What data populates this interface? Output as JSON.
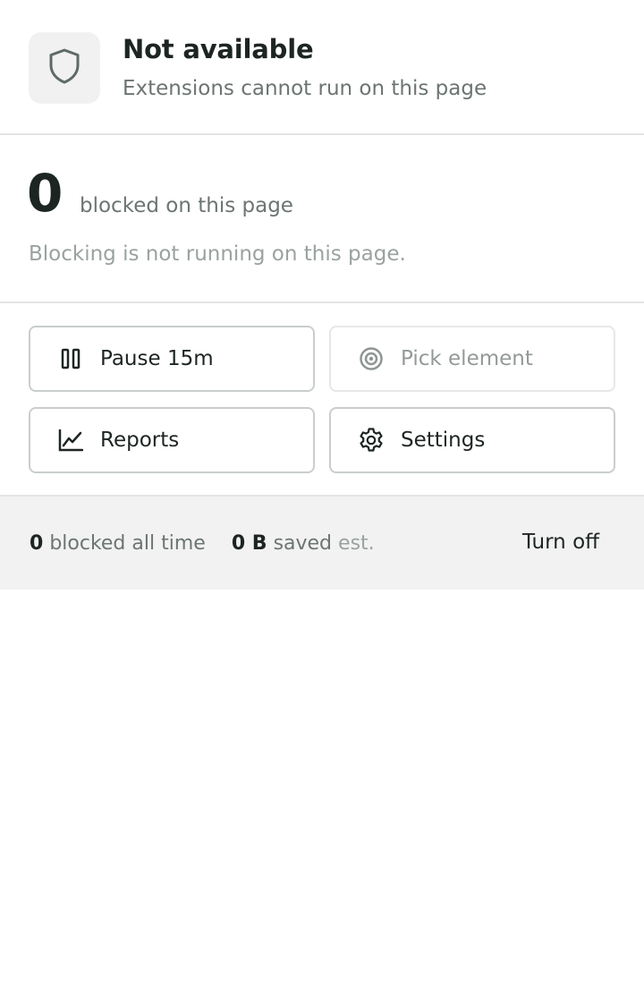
{
  "header": {
    "title": "Not available",
    "subtitle": "Extensions cannot run on this page",
    "icon": "shield-icon"
  },
  "stats": {
    "blocked_count": "0",
    "blocked_label": "blocked on this page",
    "status_note": "Blocking is not running on this page."
  },
  "actions": {
    "pause": {
      "label": "Pause 15m",
      "icon": "pause-icon",
      "enabled": true
    },
    "pick": {
      "label": "Pick element",
      "icon": "target-icon",
      "enabled": false
    },
    "reports": {
      "label": "Reports",
      "icon": "chart-icon",
      "enabled": true
    },
    "settings": {
      "label": "Settings",
      "icon": "gear-icon",
      "enabled": true
    }
  },
  "footer": {
    "all_time_count": "0",
    "all_time_label": "blocked all time",
    "saved_amount": "0 B",
    "saved_label": "saved",
    "saved_suffix": "est.",
    "turn_off_label": "Turn off"
  },
  "colors": {
    "text_primary": "#1d2522",
    "text_secondary": "#6c7571",
    "text_muted": "#9aa29f",
    "divider": "#e3e5e4",
    "footer_bg": "#f1f2f1"
  }
}
